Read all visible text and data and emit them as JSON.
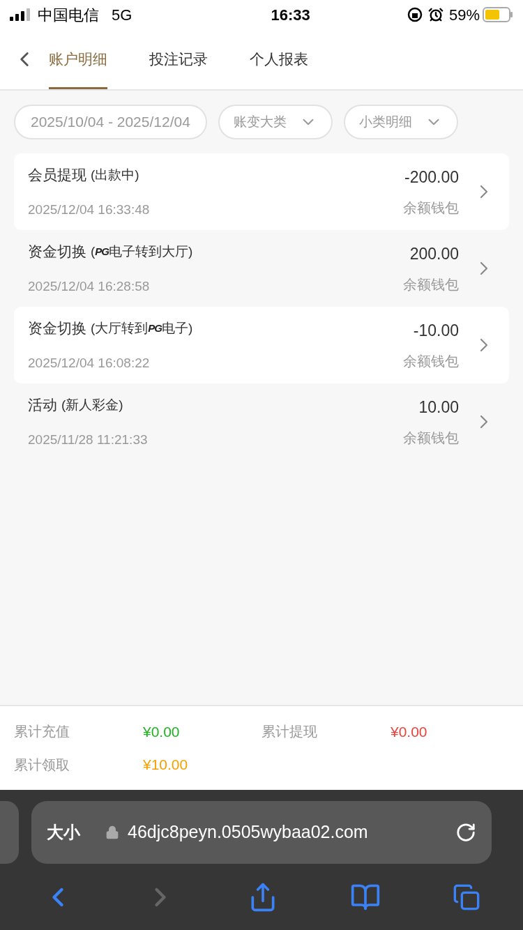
{
  "status_bar": {
    "carrier": "中国电信",
    "network": "5G",
    "time": "16:33",
    "battery": "59%"
  },
  "tabs": [
    {
      "label": "账户明细",
      "selected": true
    },
    {
      "label": "投注记录",
      "selected": false
    },
    {
      "label": "个人报表",
      "selected": false
    }
  ],
  "filters": {
    "date_range": "2025/10/04 - 2025/12/04",
    "dropdowns": [
      "账变大类",
      "小类明细"
    ]
  },
  "records": [
    {
      "title": [
        {
          "kind": "text",
          "text": "会员提现"
        },
        {
          "kind": "note",
          "text": "(出款中)"
        }
      ],
      "time": "2025/12/04 16:33:48",
      "amount": "-200.00",
      "wallet": "余额钱包"
    },
    {
      "title": [
        {
          "kind": "text",
          "text": "资金切换"
        },
        {
          "kind": "note",
          "text": "("
        },
        {
          "kind": "logo",
          "text": "PG"
        },
        {
          "kind": "note",
          "text": "电子转到大厅)"
        }
      ],
      "time": "2025/12/04 16:28:58",
      "amount": "200.00",
      "wallet": "余额钱包"
    },
    {
      "title": [
        {
          "kind": "text",
          "text": "资金切换"
        },
        {
          "kind": "note",
          "text": "(大厅转到"
        },
        {
          "kind": "logo",
          "text": "PG"
        },
        {
          "kind": "note",
          "text": "电子)"
        }
      ],
      "time": "2025/12/04 16:08:22",
      "amount": "-10.00",
      "wallet": "余额钱包"
    },
    {
      "title": [
        {
          "kind": "text",
          "text": "活动"
        },
        {
          "kind": "note",
          "text": "(新人彩金)"
        }
      ],
      "time": "2025/11/28 11:21:33",
      "amount": "10.00",
      "wallet": "余额钱包"
    }
  ],
  "summary": [
    {
      "label": "累计充值",
      "value": "¥0.00",
      "color": "#22b322"
    },
    {
      "label": "累计提现",
      "value": "¥0.00",
      "color": "#e8453c"
    },
    {
      "label": "累计领取",
      "value": "¥10.00",
      "color": "#f5a000"
    }
  ],
  "browser": {
    "text_size": "大小",
    "url": "46djc8peyn.0505wybaa02.com"
  }
}
